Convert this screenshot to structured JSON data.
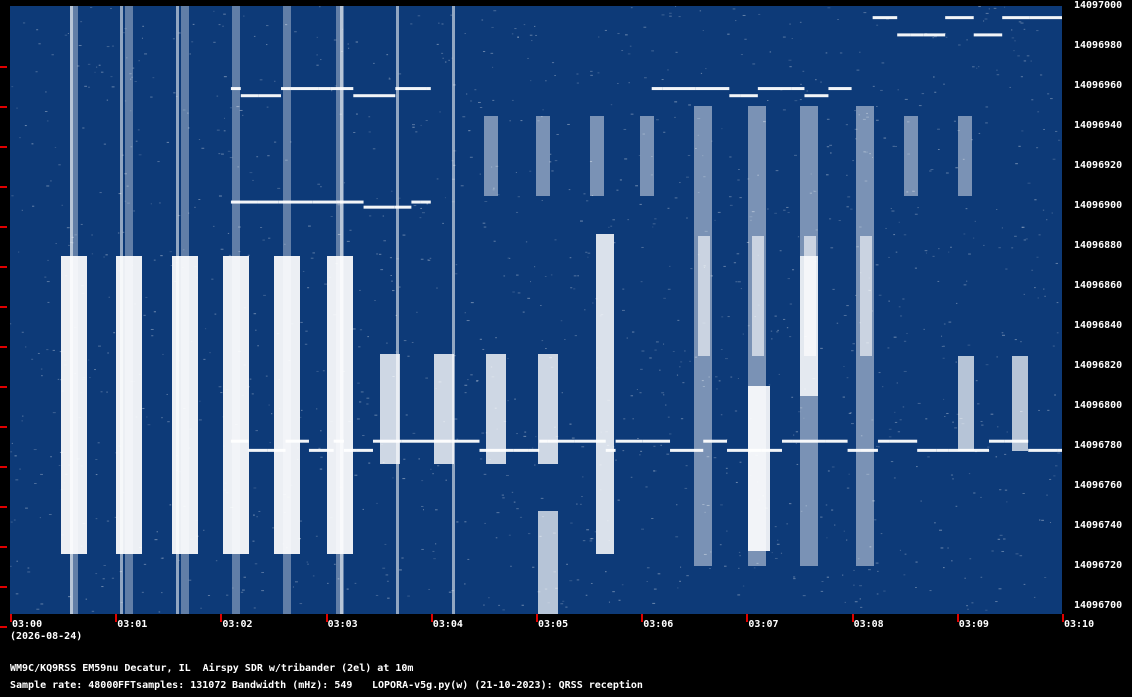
{
  "freq_axis": {
    "labels": [
      "14097000",
      "14096980",
      "14096960",
      "14096940",
      "14096920",
      "14096900",
      "14096880",
      "14096860",
      "14096840",
      "14096820",
      "14096800",
      "14096780",
      "14096760",
      "14096740",
      "14096720",
      "14096700"
    ],
    "max": 14097000,
    "min": 14096700
  },
  "time_axis": {
    "labels": [
      "03:00",
      "03:01",
      "03:02",
      "03:03",
      "03:04",
      "03:05",
      "03:06",
      "03:07",
      "03:08",
      "03:09",
      "03:10"
    ]
  },
  "date_label": "(2026-08-24)",
  "info": {
    "station": "WM9C/KQ9RSS EM59nu Decatur, IL  Airspy SDR w/tribander (2el) at 10m",
    "sample_rate": "Sample rate: 48000",
    "fft_samples": "FFTsamples: 131072",
    "bandwidth": "Bandwidth (mHz): 549",
    "software": "LOPORA-v5g.py(w) (21-10-2023): QRSS reception"
  },
  "colors": {
    "background": "#000000",
    "waterfall": "#0d3a78",
    "signal": "#ffffff",
    "ticks": "#e00000"
  },
  "chart_data": {
    "type": "heatmap",
    "x_range": [
      "03:00",
      "03:10"
    ],
    "y_range": [
      14096700,
      14097000
    ],
    "signals": [
      {
        "kind": "fsk-trace",
        "freq_low": 14096780,
        "freq_high": 14096786,
        "time_start": 2.1,
        "time_end": 10.0
      },
      {
        "kind": "fsk-trace",
        "freq_low": 14096985,
        "freq_high": 14096995,
        "time_start": 8.2,
        "time_end": 10.0
      },
      {
        "kind": "fsk-trace",
        "freq_low": 14096955,
        "freq_high": 14096960,
        "time_start": 2.1,
        "time_end": 4.0
      },
      {
        "kind": "fsk-trace",
        "freq_low": 14096955,
        "freq_high": 14096960,
        "time_start": 6.1,
        "time_end": 8.0
      },
      {
        "kind": "fsk-trace",
        "freq_low": 14096900,
        "freq_high": 14096904,
        "time_start": 2.1,
        "time_end": 4.0
      }
    ]
  }
}
